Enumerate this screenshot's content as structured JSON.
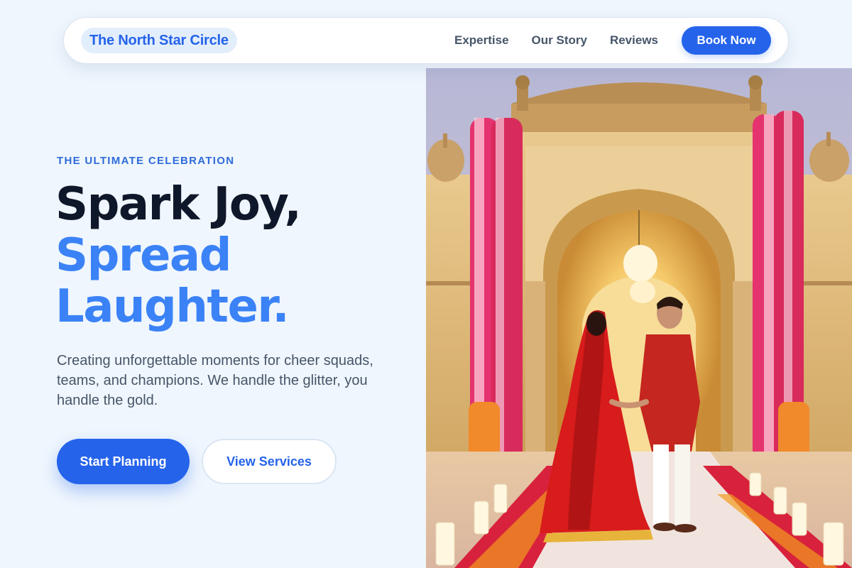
{
  "nav": {
    "brand": "The North Star Circle",
    "links": [
      "Expertise",
      "Our Story",
      "Reviews"
    ],
    "cta": "Book Now"
  },
  "hero": {
    "eyebrow": "THE ULTIMATE CELEBRATION",
    "headline_line1": "Spark Joy,",
    "headline_line2": "Spread",
    "headline_line3": "Laughter.",
    "lead": "Creating unforgettable moments for cheer squads, teams, and champions. We handle the glitter, you handle the gold.",
    "primary_button": "Start Planning",
    "secondary_button": "View Services"
  },
  "colors": {
    "accent": "#2563eb",
    "accent_light": "#3b82f6",
    "background": "#eff6fd",
    "heading": "#0f172a",
    "body_text": "#475569"
  }
}
